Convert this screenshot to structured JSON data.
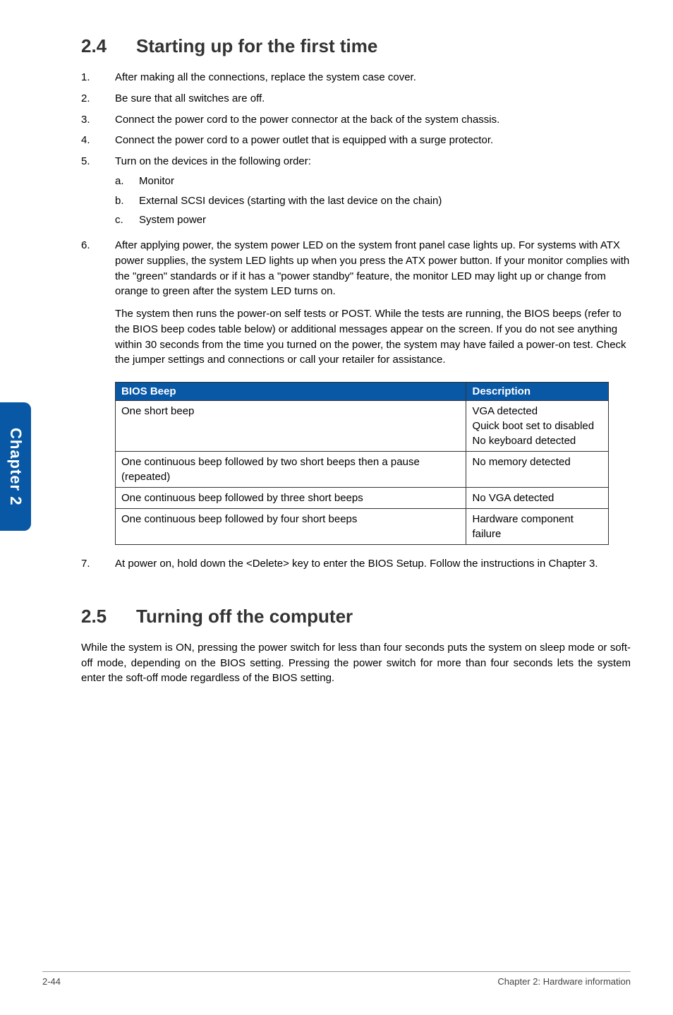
{
  "sideTab": "Chapter 2",
  "section1": {
    "num": "2.4",
    "title": "Starting up for the first time",
    "items": [
      {
        "n": "1.",
        "text": "After making all the connections, replace the system case cover."
      },
      {
        "n": "2.",
        "text": "Be sure that all switches are off."
      },
      {
        "n": "3.",
        "text": "Connect the power cord to the power connector at the back of the system chassis."
      },
      {
        "n": "4.",
        "text": "Connect the power cord to a power outlet that is equipped with a surge protector."
      },
      {
        "n": "5.",
        "text": "Turn on the devices in the following order:",
        "sub": [
          {
            "l": "a.",
            "t": "Monitor"
          },
          {
            "l": "b.",
            "t": "External SCSI devices (starting with the last device on the chain)"
          },
          {
            "l": "c.",
            "t": "System power"
          }
        ]
      },
      {
        "n": "6.",
        "text": "After applying power, the system power LED on the system front panel case lights up. For systems with ATX power supplies, the system LED lights up when you press the ATX power button. If your monitor complies with the \"green\" standards or if it has a \"power standby\" feature, the monitor LED may light up or change from orange to green after the system LED turns on.",
        "extra": "The system then runs the power-on self tests or POST. While the tests are running, the BIOS beeps (refer to the BIOS beep codes table below) or additional messages appear on the screen. If you do not see anything within 30 seconds from the time you turned on the power, the system may have failed a power-on test. Check the jumper settings and connections or call your retailer for assistance."
      }
    ],
    "table": {
      "headers": [
        "BIOS Beep",
        "Description"
      ],
      "rows": [
        [
          "One short beep",
          "VGA detected\nQuick boot set to disabled\nNo keyboard detected"
        ],
        [
          "One continuous beep followed by two short beeps then a pause (repeated)",
          "No memory detected"
        ],
        [
          "One continuous beep followed by three short beeps",
          "No VGA detected"
        ],
        [
          "One continuous beep followed by four short beeps",
          "Hardware component failure"
        ]
      ]
    },
    "item7": {
      "n": "7.",
      "text": "At power on, hold down the <Delete> key to enter the BIOS Setup. Follow the instructions in Chapter 3."
    }
  },
  "section2": {
    "num": "2.5",
    "title": "Turning off the computer",
    "body": "While the system is ON, pressing the power switch for less than four seconds puts the system on sleep mode or soft-off mode, depending on the BIOS setting. Pressing the power switch for more than four seconds lets the system enter the soft-off mode regardless of the BIOS setting."
  },
  "footer": {
    "left": "2-44",
    "right": "Chapter 2: Hardware information"
  }
}
